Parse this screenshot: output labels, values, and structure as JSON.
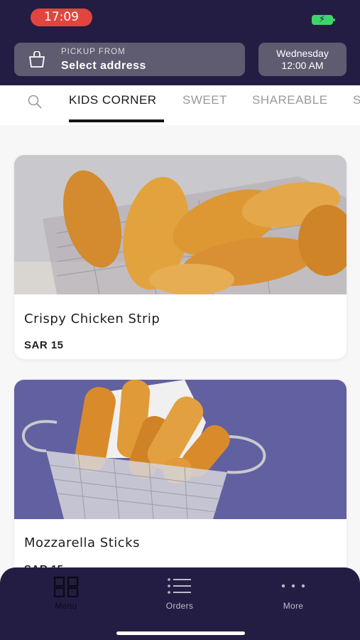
{
  "status_bar": {
    "time": "17:09"
  },
  "header": {
    "pickup_label": "PICKUP FROM",
    "pickup_value": "Select address",
    "day": "Wednesday",
    "time": "12:00 AM"
  },
  "tabs": [
    {
      "label": "KIDS CORNER",
      "active": true
    },
    {
      "label": "SWEET",
      "active": false
    },
    {
      "label": "SHAREABLE",
      "active": false
    },
    {
      "label": "S",
      "active": false
    }
  ],
  "products": [
    {
      "name": "Crispy Chicken Strip",
      "price": "SAR 15"
    },
    {
      "name": "Mozzarella Sticks",
      "price": "SAR 15"
    }
  ],
  "bottom_nav": [
    {
      "label": "Menu",
      "icon": "grid-icon",
      "active": true
    },
    {
      "label": "Orders",
      "icon": "list-icon",
      "active": false
    },
    {
      "label": "More",
      "icon": "more-dots-icon",
      "active": false
    }
  ],
  "colors": {
    "header_bg": "#241d43",
    "pill_bg": "#5f5b70",
    "time_badge": "#e2453f",
    "battery": "#3fd46b",
    "nav_active": "#0c0a16",
    "nav_inactive": "#bdbacb"
  }
}
